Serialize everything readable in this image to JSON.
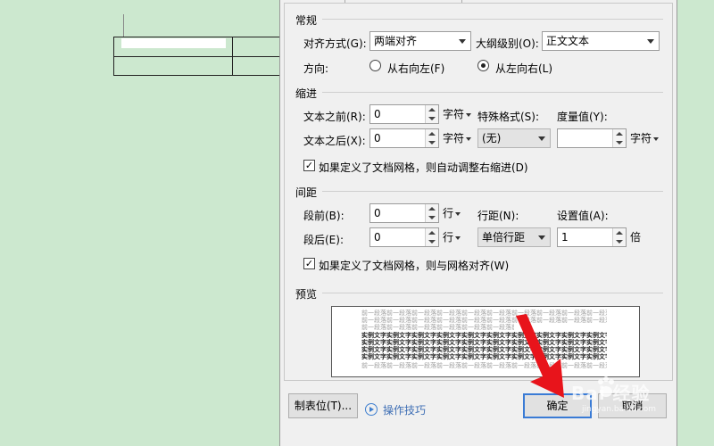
{
  "general": {
    "title": "常规",
    "alignment_label": "对齐方式(G):",
    "alignment_value": "两端对齐",
    "outline_label": "大纲级别(O):",
    "outline_value": "正文文本",
    "direction_label": "方向:",
    "rtl_label": "从右向左(F)",
    "ltr_label": "从左向右(L)"
  },
  "indent": {
    "title": "缩进",
    "before_label": "文本之前(R):",
    "before_value": "0",
    "after_label": "文本之后(X):",
    "after_value": "0",
    "unit_chars": "字符",
    "special_label": "特殊格式(S):",
    "special_value": "(无)",
    "measure_label": "度量值(Y):",
    "measure_value": "",
    "measure_unit": "字符",
    "auto_adjust_label": "如果定义了文档网格，则自动调整右缩进(D)",
    "auto_adjust_checked": "✓"
  },
  "spacing": {
    "title": "间距",
    "before_label": "段前(B):",
    "before_value": "0",
    "after_label": "段后(E):",
    "after_value": "0",
    "unit_lines": "行",
    "line_spacing_label": "行距(N):",
    "line_spacing_value": "单倍行距",
    "set_value_label": "设置值(A):",
    "set_value": "1",
    "set_value_unit": "倍",
    "snap_grid_label": "如果定义了文档网格，则与网格对齐(W)",
    "snap_grid_checked": "✓"
  },
  "preview": {
    "title": "预览",
    "light_text": "前一段落前一段落前一段落前一段落前一段落前一段落前一段落前一段落前一段落前一段落前一段落前一段落前一段落前一段落",
    "dark_text": "实例文字实例文字实例文字实例文字实例文字实例文字实例文字实例文字实例文字实例文字实例文字实例文字实例文字"
  },
  "buttons": {
    "tabs_label": "制表位(T)...",
    "tips_label": "操作技巧",
    "ok_label": "确定",
    "cancel_label": "取消"
  },
  "watermark": {
    "brand": "Bai 经验",
    "url": "jingyan.baidu.com"
  },
  "colors": {
    "background": "#cce8cf",
    "dialog": "#f0f0f0",
    "ok_border": "#3a7bd5",
    "arrow": "#e8141b",
    "link": "#3f6fb5"
  }
}
